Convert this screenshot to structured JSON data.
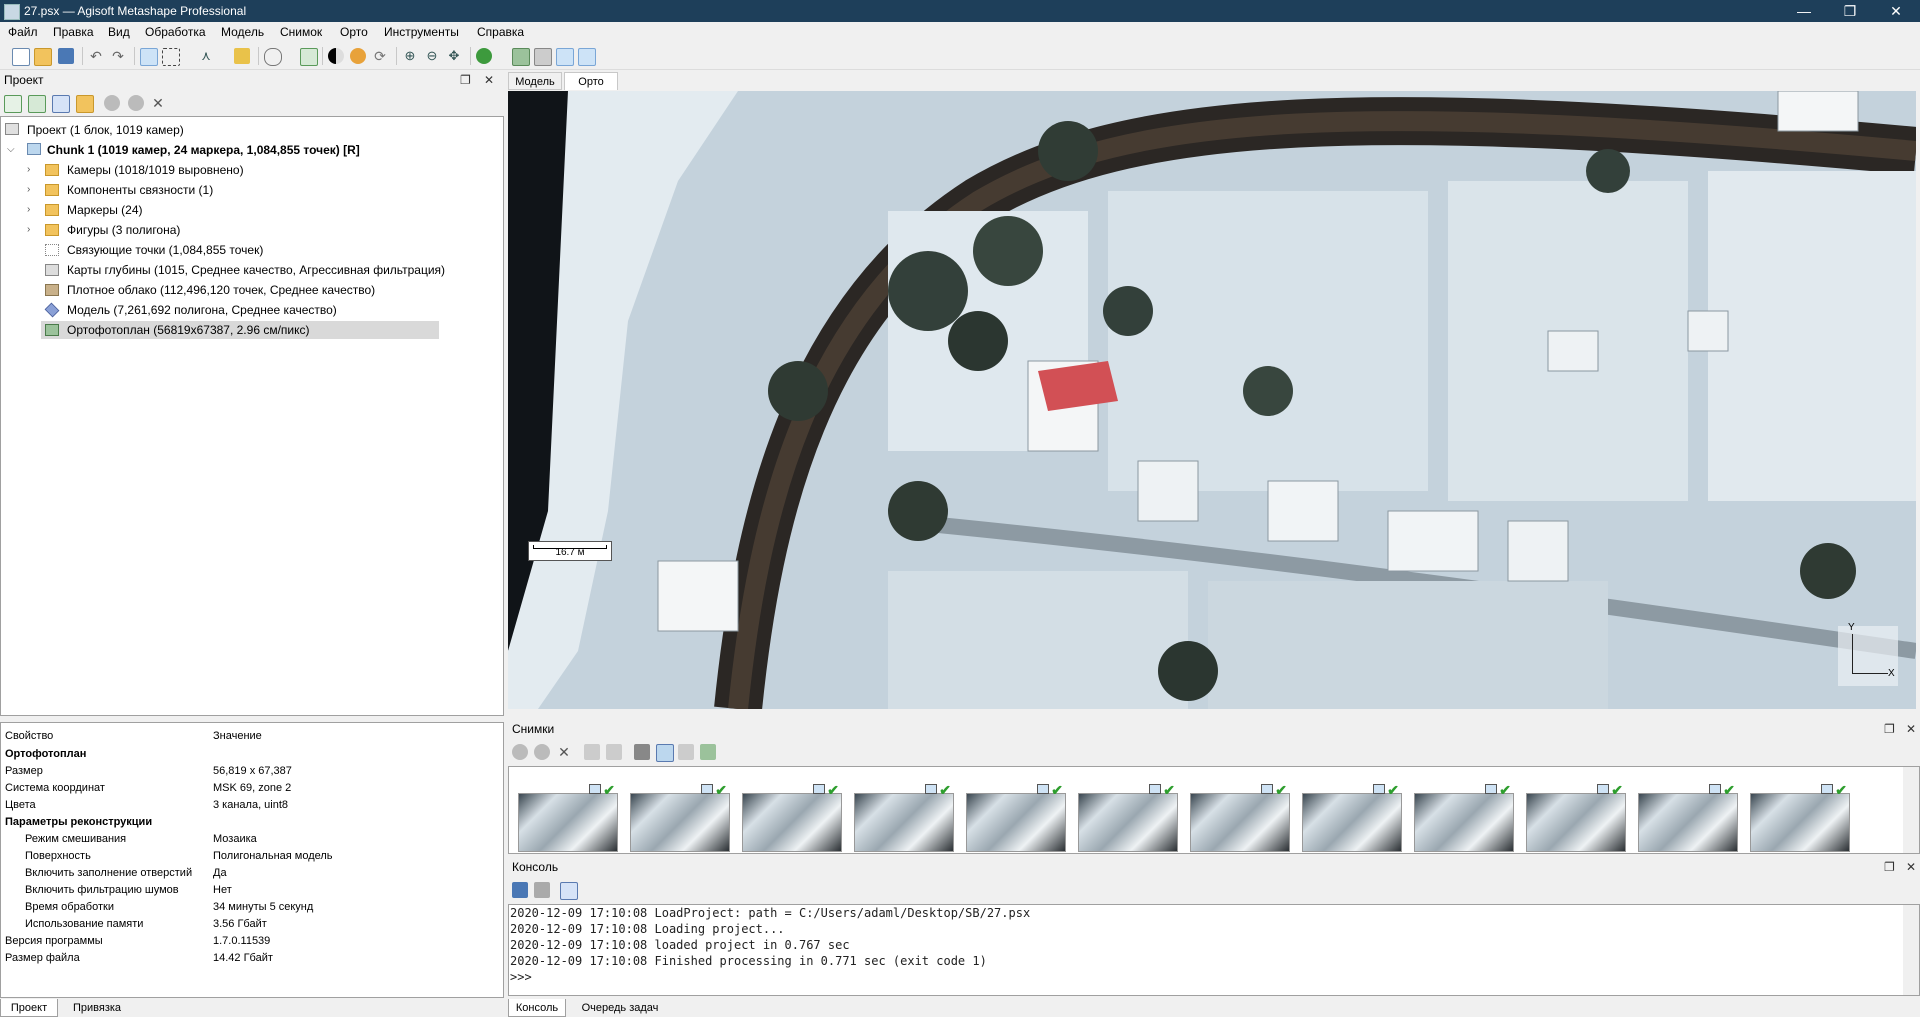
{
  "window": {
    "title": "27.psx — Agisoft Metashape Professional",
    "min": "—",
    "max": "❐",
    "close": "✕"
  },
  "menu": [
    "Файл",
    "Правка",
    "Вид",
    "Обработка",
    "Модель",
    "Снимок",
    "Орто",
    "Инструменты",
    "Справка"
  ],
  "project_panel": {
    "title": "Проект",
    "root": "Проект (1 блок, 1019 камер)",
    "chunk": "Chunk 1 (1019 камер, 24 маркера, 1,084,855 точек) [R]",
    "items": [
      "Камеры (1018/1019 выровнено)",
      "Компоненты связности (1)",
      "Маркеры (24)",
      "Фигуры (3 полигона)",
      "Связующие точки (1,084,855 точек)",
      "Карты глубины (1015, Среднее качество, Агрессивная фильтрация)",
      "Плотное облако (112,496,120 точек, Среднее качество)",
      "Модель (7,261,692 полигона, Среднее качество)",
      "Ортофотоплан (56819x67387, 2.96 см/пикс)"
    ]
  },
  "properties": {
    "header_key": "Свойство",
    "header_value": "Значение",
    "rows": [
      {
        "k": "Ортофотоплан",
        "v": "",
        "bold": true
      },
      {
        "k": "Размер",
        "v": "56,819 x 67,387"
      },
      {
        "k": "Система координат",
        "v": "MSK 69, zone 2"
      },
      {
        "k": "Цвета",
        "v": "3 канала, uint8"
      },
      {
        "k": "Параметры реконструкции",
        "v": "",
        "bold": true
      },
      {
        "k": "Режим смешивания",
        "v": "Мозаика",
        "indent": true
      },
      {
        "k": "Поверхность",
        "v": "Полигональная модель",
        "indent": true
      },
      {
        "k": "Включить заполнение отверстий",
        "v": "Да",
        "indent": true
      },
      {
        "k": "Включить фильтрацию шумов",
        "v": "Нет",
        "indent": true
      },
      {
        "k": "Время обработки",
        "v": "34 минуты 5 секунд",
        "indent": true
      },
      {
        "k": "Использование памяти",
        "v": "3.56 Гбайт",
        "indent": true
      },
      {
        "k": "Версия программы",
        "v": "1.7.0.11539"
      },
      {
        "k": "Размер файла",
        "v": "14.42 Гбайт"
      }
    ]
  },
  "left_tabs": [
    "Проект",
    "Привязка"
  ],
  "view_tabs": [
    "Модель",
    "Орто"
  ],
  "scale_label": "16.7 м",
  "axes": {
    "y": "Y",
    "x": "X"
  },
  "photos_panel": {
    "title": "Снимки",
    "count": 12
  },
  "console_panel": {
    "title": "Консоль",
    "lines": [
      "2020-12-09 17:10:08 LoadProject: path = C:/Users/adaml/Desktop/SB/27.psx",
      "2020-12-09 17:10:08 Loading project...",
      "2020-12-09 17:10:08 loaded project in 0.767 sec",
      "2020-12-09 17:10:08 Finished processing in 0.771 sec (exit code 1)"
    ],
    "prompt": ">>>"
  },
  "bottom_tabs": [
    "Консоль",
    "Очередь задач"
  ]
}
